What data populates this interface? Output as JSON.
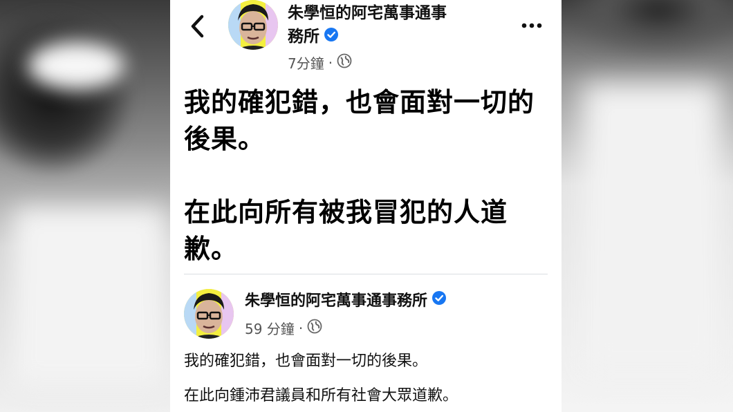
{
  "post": {
    "page_name": "朱學恒的阿宅萬事通事務所",
    "page_name_line1": "朱學恒的阿宅萬事通事",
    "page_name_line2": "務所",
    "time": "7分鐘",
    "separator": "·",
    "privacy_icon": "globe-icon",
    "body_paragraph_1": "我的確犯錯，也會面對一切的後果。",
    "body_paragraph_2": "在此向所有被我冒犯的人道歉。"
  },
  "shared_post": {
    "page_name": "朱學恒的阿宅萬事通事務所",
    "time": "59 分鐘",
    "separator": "·",
    "privacy_icon": "globe-icon",
    "body_paragraph_1": "我的確犯錯，也會面對一切的後果。",
    "body_paragraph_2": "在此向鍾沛君議員和所有社會大眾道歉。"
  },
  "icons": {
    "back": "chevron-left-icon",
    "more": "more-options-icon",
    "verified": "verified-badge-icon"
  },
  "colors": {
    "verified_blue": "#1877f2",
    "text_primary": "#111111",
    "text_secondary": "#555555",
    "avatar_accent": "#f4ef3f"
  }
}
